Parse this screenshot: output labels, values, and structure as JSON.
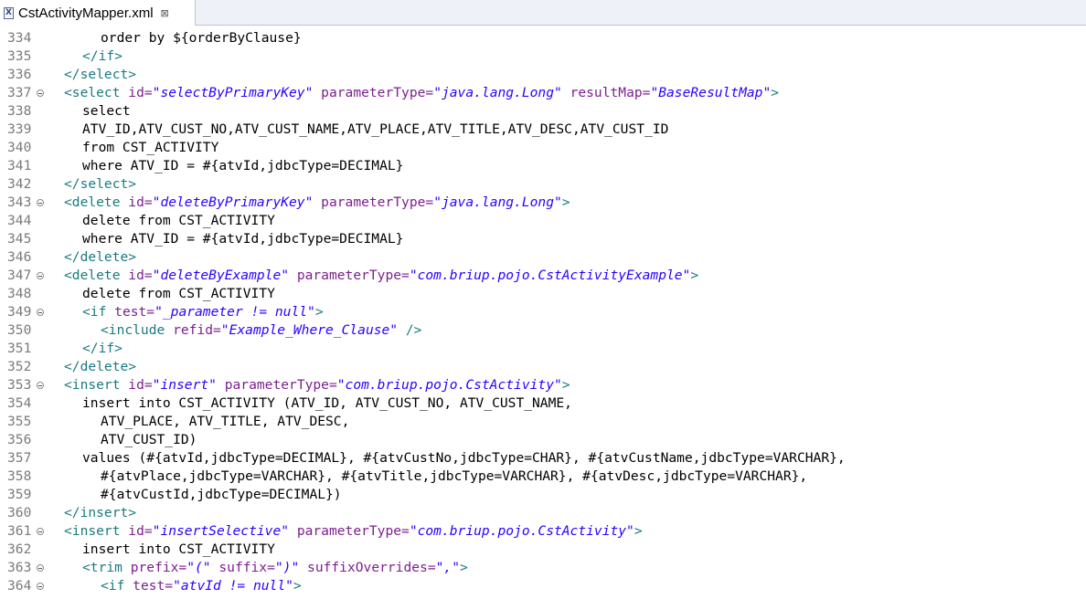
{
  "tab": {
    "title": "CstActivityMapper.xml",
    "close_icon": "⊠"
  },
  "editor": {
    "lines": [
      {
        "num": "334",
        "indent": 2,
        "segs": [
          [
            "p",
            "order by ${orderByClause}"
          ]
        ]
      },
      {
        "num": "335",
        "indent": 1,
        "segs": [
          [
            "t",
            "</if>"
          ]
        ]
      },
      {
        "num": "336",
        "indent": 0,
        "segs": [
          [
            "t",
            "</select>"
          ]
        ]
      },
      {
        "num": "337",
        "fold": true,
        "indent": 0,
        "segs": [
          [
            "t",
            "<select "
          ],
          [
            "a",
            "id="
          ],
          [
            "v",
            "\"selectByPrimaryKey\""
          ],
          [
            "a",
            " parameterType="
          ],
          [
            "v",
            "\"java.lang.Long\""
          ],
          [
            "a",
            " resultMap="
          ],
          [
            "v",
            "\"BaseResultMap\""
          ],
          [
            "t",
            ">"
          ]
        ]
      },
      {
        "num": "338",
        "indent": 1,
        "segs": [
          [
            "p",
            "select"
          ]
        ]
      },
      {
        "num": "339",
        "indent": 1,
        "segs": [
          [
            "p",
            "ATV_ID,ATV_CUST_NO,ATV_CUST_NAME,ATV_PLACE,ATV_TITLE,ATV_DESC,ATV_CUST_ID"
          ]
        ]
      },
      {
        "num": "340",
        "indent": 1,
        "segs": [
          [
            "p",
            "from CST_ACTIVITY"
          ]
        ]
      },
      {
        "num": "341",
        "indent": 1,
        "segs": [
          [
            "p",
            "where ATV_ID = #{atvId,jdbcType=DECIMAL}"
          ]
        ]
      },
      {
        "num": "342",
        "indent": 0,
        "segs": [
          [
            "t",
            "</select>"
          ]
        ]
      },
      {
        "num": "343",
        "fold": true,
        "indent": 0,
        "segs": [
          [
            "t",
            "<delete "
          ],
          [
            "a",
            "id="
          ],
          [
            "v",
            "\"deleteByPrimaryKey\""
          ],
          [
            "a",
            " parameterType="
          ],
          [
            "v",
            "\"java.lang.Long\""
          ],
          [
            "t",
            ">"
          ]
        ]
      },
      {
        "num": "344",
        "indent": 1,
        "segs": [
          [
            "p",
            "delete from CST_ACTIVITY"
          ]
        ]
      },
      {
        "num": "345",
        "indent": 1,
        "segs": [
          [
            "p",
            "where ATV_ID = #{atvId,jdbcType=DECIMAL}"
          ]
        ]
      },
      {
        "num": "346",
        "indent": 0,
        "segs": [
          [
            "t",
            "</delete>"
          ]
        ]
      },
      {
        "num": "347",
        "fold": true,
        "indent": 0,
        "segs": [
          [
            "t",
            "<delete "
          ],
          [
            "a",
            "id="
          ],
          [
            "v",
            "\"deleteByExample\""
          ],
          [
            "a",
            " parameterType="
          ],
          [
            "v",
            "\"com.briup.pojo.CstActivityExample\""
          ],
          [
            "t",
            ">"
          ]
        ]
      },
      {
        "num": "348",
        "indent": 1,
        "segs": [
          [
            "p",
            "delete from CST_ACTIVITY"
          ]
        ]
      },
      {
        "num": "349",
        "fold": true,
        "indent": 1,
        "segs": [
          [
            "t",
            "<if "
          ],
          [
            "a",
            "test="
          ],
          [
            "v",
            "\"_parameter != null\""
          ],
          [
            "t",
            ">"
          ]
        ]
      },
      {
        "num": "350",
        "indent": 2,
        "segs": [
          [
            "t",
            "<include "
          ],
          [
            "a",
            "refid="
          ],
          [
            "v",
            "\"Example_Where_Clause\""
          ],
          [
            "t",
            " />"
          ]
        ]
      },
      {
        "num": "351",
        "indent": 1,
        "segs": [
          [
            "t",
            "</if>"
          ]
        ]
      },
      {
        "num": "352",
        "indent": 0,
        "segs": [
          [
            "t",
            "</delete>"
          ]
        ]
      },
      {
        "num": "353",
        "fold": true,
        "indent": 0,
        "segs": [
          [
            "t",
            "<insert "
          ],
          [
            "a",
            "id="
          ],
          [
            "v",
            "\"insert\""
          ],
          [
            "a",
            " parameterType="
          ],
          [
            "v",
            "\"com.briup.pojo.CstActivity\""
          ],
          [
            "t",
            ">"
          ]
        ]
      },
      {
        "num": "354",
        "indent": 1,
        "segs": [
          [
            "p",
            "insert into CST_ACTIVITY (ATV_ID, ATV_CUST_NO, ATV_CUST_NAME,"
          ]
        ]
      },
      {
        "num": "355",
        "indent": 2,
        "segs": [
          [
            "p",
            "ATV_PLACE, ATV_TITLE, ATV_DESC,"
          ]
        ]
      },
      {
        "num": "356",
        "indent": 2,
        "segs": [
          [
            "p",
            "ATV_CUST_ID)"
          ]
        ]
      },
      {
        "num": "357",
        "indent": 1,
        "segs": [
          [
            "p",
            "values (#{atvId,jdbcType=DECIMAL}, #{atvCustNo,jdbcType=CHAR}, #{atvCustName,jdbcType=VARCHAR},"
          ]
        ]
      },
      {
        "num": "358",
        "indent": 2,
        "segs": [
          [
            "p",
            "#{atvPlace,jdbcType=VARCHAR}, #{atvTitle,jdbcType=VARCHAR}, #{atvDesc,jdbcType=VARCHAR},"
          ]
        ]
      },
      {
        "num": "359",
        "indent": 2,
        "segs": [
          [
            "p",
            "#{atvCustId,jdbcType=DECIMAL})"
          ]
        ]
      },
      {
        "num": "360",
        "indent": 0,
        "segs": [
          [
            "t",
            "</insert>"
          ]
        ]
      },
      {
        "num": "361",
        "fold": true,
        "indent": 0,
        "segs": [
          [
            "t",
            "<insert "
          ],
          [
            "a",
            "id="
          ],
          [
            "v",
            "\"insertSelective\""
          ],
          [
            "a",
            " parameterType="
          ],
          [
            "v",
            "\"com.briup.pojo.CstActivity\""
          ],
          [
            "t",
            ">"
          ]
        ]
      },
      {
        "num": "362",
        "indent": 1,
        "segs": [
          [
            "p",
            "insert into CST_ACTIVITY"
          ]
        ]
      },
      {
        "num": "363",
        "fold": true,
        "indent": 1,
        "segs": [
          [
            "t",
            "<trim "
          ],
          [
            "a",
            "prefix="
          ],
          [
            "v",
            "\"(\""
          ],
          [
            "a",
            " suffix="
          ],
          [
            "v",
            "\")\""
          ],
          [
            "a",
            " suffixOverrides="
          ],
          [
            "v",
            "\",\""
          ],
          [
            "t",
            ">"
          ]
        ]
      },
      {
        "num": "364",
        "fold": true,
        "indent": 2,
        "segs": [
          [
            "t",
            "<if "
          ],
          [
            "a",
            "test="
          ],
          [
            "v",
            "\"atvId != null\""
          ],
          [
            "t",
            ">"
          ]
        ]
      }
    ]
  }
}
